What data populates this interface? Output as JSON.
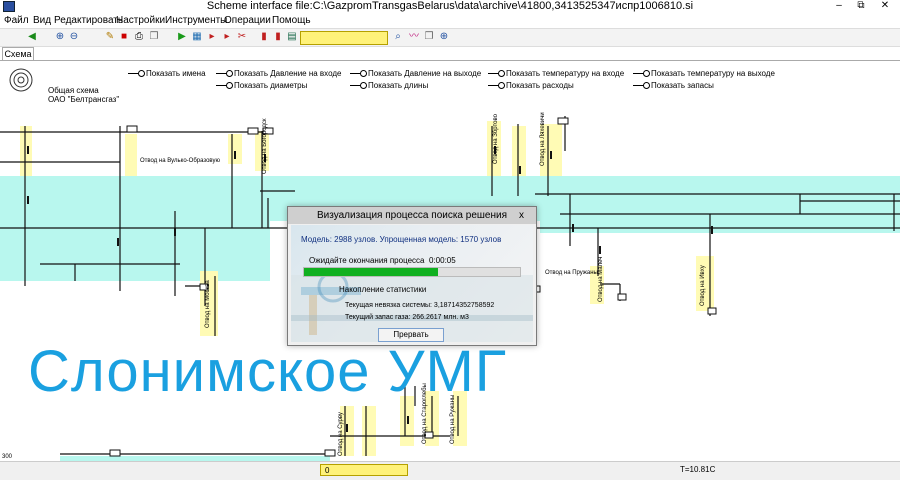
{
  "window": {
    "title": "Scheme interface file:C:\\GazpromTransgasBelarus\\data\\archive\\41800,3413525347испр1006810.si",
    "minimize": "–",
    "maximize": "⧉",
    "close": "✕"
  },
  "menu": [
    "Файл",
    "Вид",
    "Редактировать",
    "Настройки",
    "Инструменты",
    "Операции",
    "Помощь"
  ],
  "toolbar": {
    "icons": [
      "back-arrow-icon",
      "zoom-in-icon",
      "zoom-out-icon",
      "pencil-icon",
      "stop-icon",
      "print-icon",
      "copy-icon",
      "play-icon",
      "grid-icon",
      "marker-1-icon",
      "marker-2-icon",
      "marker-3-icon",
      "tool-1-icon",
      "tool-2-icon",
      "tool-3-icon",
      "table-icon",
      "search-icon",
      "chart-icon",
      "pages-icon",
      "zoom-icon"
    ],
    "search_value": ""
  },
  "tabs": [
    "Схема"
  ],
  "header": {
    "schema_title_line1": "Общая схема",
    "schema_title_line2": "ОАО \"Белтрансгаз\"",
    "options": [
      "Показать имена",
      "Показать Давление на входе",
      "Показать Давление на выходе",
      "Показать температуру на входе",
      "Показать температуру на выходе",
      "Показать диаметры",
      "Показать длины",
      "Показать расходы",
      "Показать запасы"
    ]
  },
  "canvas": {
    "region_label": "Слонимское УМГ",
    "branches": [
      "Отвод на Вулько-Образовую",
      "Отвод на Богородск",
      "Отвод на Збртово",
      "Отвод на Ляхевичи",
      "Отвод на Пружаны",
      "Отвод на Малеч",
      "Отвод на Ивху",
      "Отвод на Москва",
      "Отвод на Сурву",
      "Отвод на Староглебы",
      "Отвод на Ружаны"
    ],
    "node_number": "300"
  },
  "dialog": {
    "title": "Визуализация процесса поиска решения",
    "close": "x",
    "model_text": "Модель: 2988 узлов. Упрощенная модель: 1570 узлов",
    "wait_label": "Ожидайте окончания процесса",
    "elapsed": "0:00:05",
    "progress": 0.62,
    "accum_label": "Накопление статистики",
    "residual": "Текущая невязка системы: 3,18714352758592",
    "gas_stock": "Текущий запас газа: 266.2617 млн. м3",
    "abort_button": "Прервать"
  },
  "status": {
    "field_value": "0",
    "temperature": "T=10.81C"
  },
  "colors": {
    "cyan_band": "#b8f7ee",
    "yellow_hl": "#fffbb5",
    "accent_blue": "#1aa0e0",
    "progress_green": "#10b020"
  }
}
